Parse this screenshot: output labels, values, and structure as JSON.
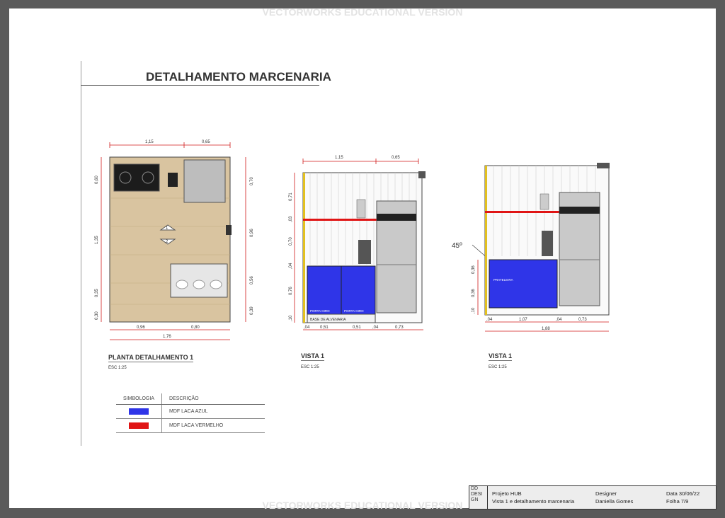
{
  "watermark": "VECTORWORKS EDUCATIONAL VERSION",
  "title": "DETALHAMENTO MARCENARIA",
  "plan": {
    "label": "PLANTA DETALHAMENTO 1",
    "scale": "ESC 1:25",
    "dim_top": [
      "1,15",
      "0,65"
    ],
    "dim_left": [
      "0,60",
      "1,35",
      "0,35",
      "0,30"
    ],
    "dim_right": [
      "0,70",
      "0,96",
      "0,56",
      "0,39"
    ],
    "dim_bottom": [
      "0,96",
      "0,80"
    ],
    "dim_total": "1,76",
    "markers": [
      "1",
      "2"
    ]
  },
  "vista1": {
    "label": "VISTA 1",
    "scale": "ESC 1:25",
    "dim_top": [
      "1,15",
      "0,65"
    ],
    "dim_left": [
      "0,71",
      ",03",
      "0,70",
      ",04",
      "0,76",
      ",10"
    ],
    "dim_bottom": [
      ",04",
      "0,51",
      "0,51",
      ",04",
      "0,73"
    ],
    "door_labels": [
      "PORTA GIRO",
      "PORTA GIRO"
    ],
    "base_label": "BASE DE ALVENARIA"
  },
  "vista2": {
    "label": "VISTA 1",
    "scale": "ESC 1:25",
    "angle": "45º",
    "dim_left": [
      "0,36",
      "0,36",
      ",10"
    ],
    "dim_bottom": [
      ",04",
      "1,07",
      ",04",
      "0,73"
    ],
    "dim_total": "1,88",
    "shelf_label": "PRATELEIRA"
  },
  "legend": {
    "col1": "SIMBOLOGIA",
    "col2": "DESCRIÇÃO",
    "rows": [
      {
        "color": "#2f35e8",
        "desc": "MDF LACA AZUL"
      },
      {
        "color": "#e01515",
        "desc": "MDF LACA VERMELHO"
      }
    ]
  },
  "titleblock": {
    "logo": "DD DESI GN",
    "project": "Projeto HUB",
    "subtitle": "Vista 1 e detalhamento marcenaria",
    "designer_label": "Designer",
    "designer": "Daniella Gomes",
    "date": "Data 30/06/22",
    "sheet": "Folha 7/9"
  },
  "colors": {
    "blue": "#2f35e8",
    "red": "#e01515",
    "dim": "#d11a1a",
    "wood": "#d9c4a0"
  }
}
